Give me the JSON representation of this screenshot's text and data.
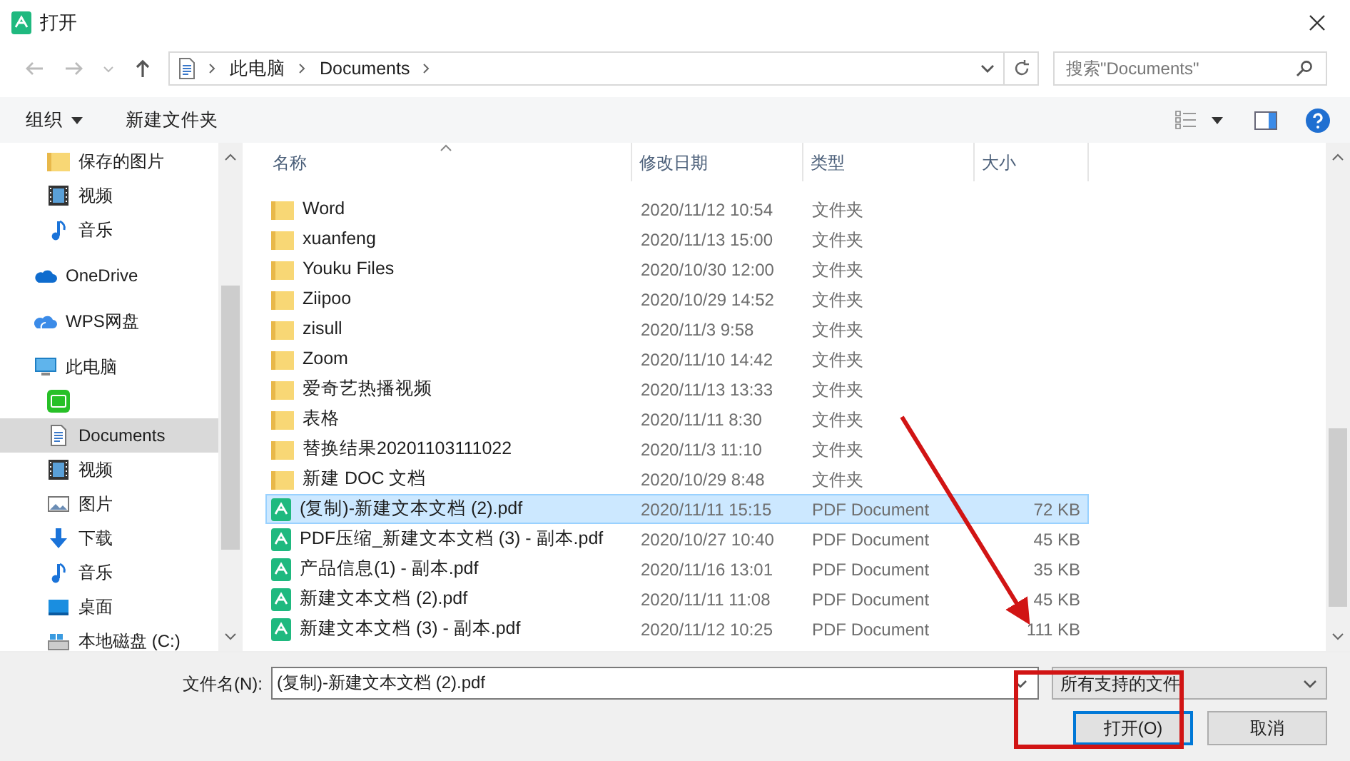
{
  "window": {
    "title": "打开"
  },
  "address_bar": {
    "path": [
      "此电脑",
      "Documents"
    ]
  },
  "search": {
    "placeholder": "搜索\"Documents\""
  },
  "toolbar": {
    "organize": "组织",
    "new_folder": "新建文件夹"
  },
  "sidebar": {
    "top_items": [
      {
        "label": "保存的图片",
        "kind": "folder",
        "selected": false
      },
      {
        "label": "视频",
        "kind": "video",
        "selected": false
      },
      {
        "label": "音乐",
        "kind": "music",
        "selected": false
      }
    ],
    "items": [
      {
        "label": "OneDrive",
        "kind": "cloud",
        "selected": false
      },
      {
        "label": "WPS网盘",
        "kind": "wps",
        "selected": false
      },
      {
        "label": "此电脑",
        "kind": "pc",
        "selected": false,
        "children": [
          {
            "kind": "iqiyi",
            "selected": false
          },
          {
            "label": "Documents",
            "kind": "doc",
            "selected": true
          },
          {
            "label": "视频",
            "kind": "video",
            "selected": false
          },
          {
            "label": "图片",
            "kind": "picture",
            "selected": false
          },
          {
            "label": "下载",
            "kind": "download",
            "selected": false
          },
          {
            "label": "音乐",
            "kind": "music",
            "selected": false
          },
          {
            "label": "桌面",
            "kind": "desktop",
            "selected": false
          },
          {
            "label": "本地磁盘 (C:)",
            "kind": "drive",
            "selected": false
          }
        ]
      }
    ]
  },
  "table": {
    "columns": [
      "名称",
      "修改日期",
      "类型",
      "大小"
    ],
    "rows": [
      {
        "name": "Word",
        "date": "2020/11/12 10:54",
        "type": "文件夹",
        "kind": "folder",
        "selected": false
      },
      {
        "name": "xuanfeng",
        "date": "2020/11/13 15:00",
        "type": "文件夹",
        "kind": "folder",
        "selected": false
      },
      {
        "name": "Youku Files",
        "date": "2020/10/30 12:00",
        "type": "文件夹",
        "kind": "folder",
        "selected": false
      },
      {
        "name": "Ziipoo",
        "date": "2020/10/29 14:52",
        "type": "文件夹",
        "kind": "folder",
        "selected": false
      },
      {
        "name": "zisull",
        "date": "2020/11/3 9:58",
        "type": "文件夹",
        "kind": "folder",
        "selected": false
      },
      {
        "name": "Zoom",
        "date": "2020/11/10 14:42",
        "type": "文件夹",
        "kind": "folder",
        "selected": false
      },
      {
        "name": "爱奇艺热播视频",
        "date": "2020/11/13 13:33",
        "type": "文件夹",
        "kind": "folder",
        "selected": false
      },
      {
        "name": "表格",
        "date": "2020/11/11 8:30",
        "type": "文件夹",
        "kind": "folder",
        "selected": false
      },
      {
        "name": "替换结果20201103111022",
        "date": "2020/11/3 11:10",
        "type": "文件夹",
        "kind": "folder",
        "selected": false
      },
      {
        "name": "新建 DOC 文档",
        "date": "2020/10/29 8:48",
        "type": "文件夹",
        "kind": "folder",
        "selected": false
      },
      {
        "name": "(复制)-新建文本文档 (2).pdf",
        "date": "2020/11/11 15:15",
        "type": "PDF Document",
        "size": "72 KB",
        "kind": "pdf",
        "selected": true
      },
      {
        "name": "PDF压缩_新建文本文档 (3) - 副本.pdf",
        "date": "2020/10/27 10:40",
        "type": "PDF Document",
        "size": "45 KB",
        "kind": "pdf",
        "selected": false
      },
      {
        "name": "产品信息(1) - 副本.pdf",
        "date": "2020/11/16 13:01",
        "type": "PDF Document",
        "size": "35 KB",
        "kind": "pdf",
        "selected": false
      },
      {
        "name": "新建文本文档 (2).pdf",
        "date": "2020/11/11 11:08",
        "type": "PDF Document",
        "size": "45 KB",
        "kind": "pdf",
        "selected": false
      },
      {
        "name": "新建文本文档 (3) - 副本.pdf",
        "date": "2020/11/12 10:25",
        "type": "PDF Document",
        "size": "111 KB",
        "kind": "pdf",
        "selected": false
      }
    ]
  },
  "footer": {
    "filename_label": "文件名(N):",
    "filename": "(复制)-新建文本文档 (2).pdf",
    "filter": "所有支持的文件",
    "open": "打开(O)",
    "cancel": "取消"
  }
}
